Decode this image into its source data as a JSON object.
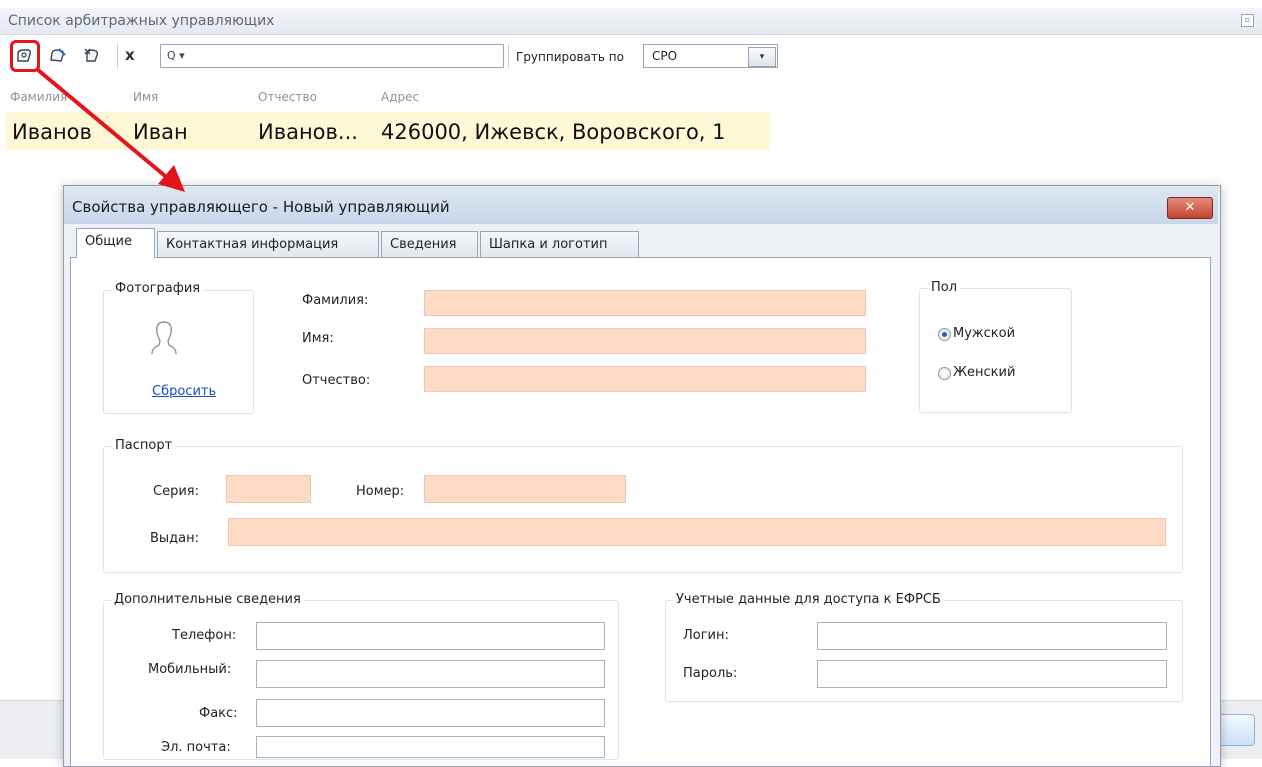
{
  "list_window": {
    "title": "Список арбитражных управляющих",
    "restore_glyph": "▫",
    "toolbar": {
      "clear_label": "x",
      "search_placeholder": "Q ▾",
      "group_label": "Группировать по",
      "group_value": "СРО",
      "group_arrow": "▾"
    },
    "columns": [
      "Фамилия",
      "Имя",
      "Отчество",
      "Адрес"
    ],
    "rows": [
      {
        "last_name": "Иванов",
        "first_name": "Иван",
        "middle_name": "Иванов...",
        "address": "426000, Ижевск, Воровского, 1"
      }
    ]
  },
  "dialog": {
    "title": "Свойства управляющего - Новый управляющий",
    "close_glyph": "✕",
    "tabs": [
      "Общие",
      "Контактная информация",
      "Сведения",
      "Шапка и логотип"
    ],
    "active_tab": "Общие",
    "photo": {
      "title": "Фотография",
      "reset_label": "Сбросить"
    },
    "name_fields": {
      "last_name_label": "Фамилия:",
      "first_name_label": "Имя:",
      "middle_name_label": "Отчество:"
    },
    "gender": {
      "title": "Пол",
      "male": "Мужской",
      "female": "Женский",
      "selected": "Мужской"
    },
    "passport": {
      "title": "Паспорт",
      "series_label": "Серия:",
      "number_label": "Номер:",
      "issued_label": "Выдан:"
    },
    "additional": {
      "title": "Дополнительные сведения",
      "phone_label": "Телефон:",
      "mobile_label": "Мобильный:",
      "fax_label": "Факс:",
      "email_label": "Эл. почта:"
    },
    "efrsb": {
      "title": "Учетные данные для доступа к ЕФРСБ",
      "login_label": "Логин:",
      "password_label": "Пароль:"
    }
  },
  "colors": {
    "required_field": "#ffdac4",
    "selected_row": "#fff8d6",
    "annotation": "#e3141b",
    "link": "#1a49c7"
  }
}
